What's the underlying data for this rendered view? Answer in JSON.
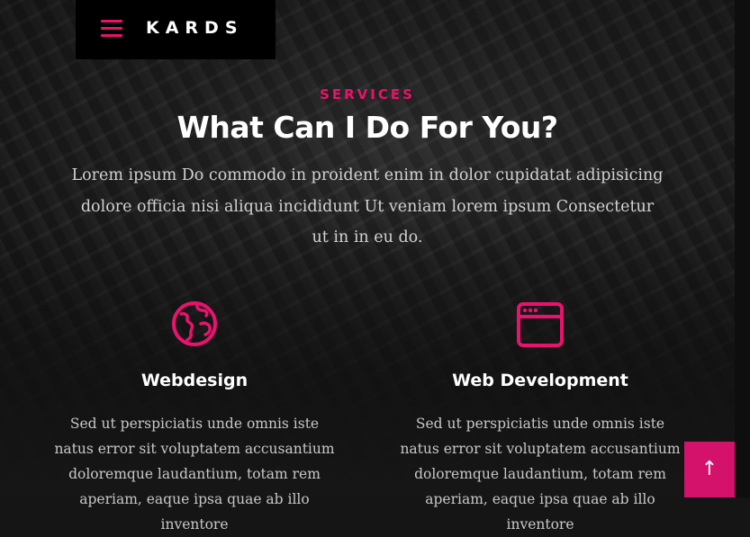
{
  "header": {
    "brand": "KARDS",
    "menu_icon": "hamburger-menu-icon"
  },
  "section": {
    "eyebrow": "SERVICES",
    "title": "What Can I Do For You?",
    "intro": "Lorem ipsum Do commodo in proident enim in dolor cupidatat adipisicing dolore officia nisi aliqua incididunt Ut veniam lorem ipsum Consectetur ut in in eu do."
  },
  "services": [
    {
      "icon": "globe-icon",
      "title": "Webdesign",
      "text": "Sed ut perspiciatis unde omnis iste natus error sit voluptatem accusantium doloremque laudantium, totam rem aperiam, eaque ipsa quae ab illo inventore"
    },
    {
      "icon": "browser-window-icon",
      "title": "Web Development",
      "text": "Sed ut perspiciatis unde omnis iste natus error sit voluptatem accusantium doloremque laudantium, totam rem aperiam, eaque ipsa quae ab illo inventore"
    }
  ],
  "back_to_top": {
    "icon": "arrow-up-icon",
    "glyph": "↑"
  },
  "colors": {
    "accent": "#e8136c",
    "back_to_top_bg": "#d4126b"
  }
}
